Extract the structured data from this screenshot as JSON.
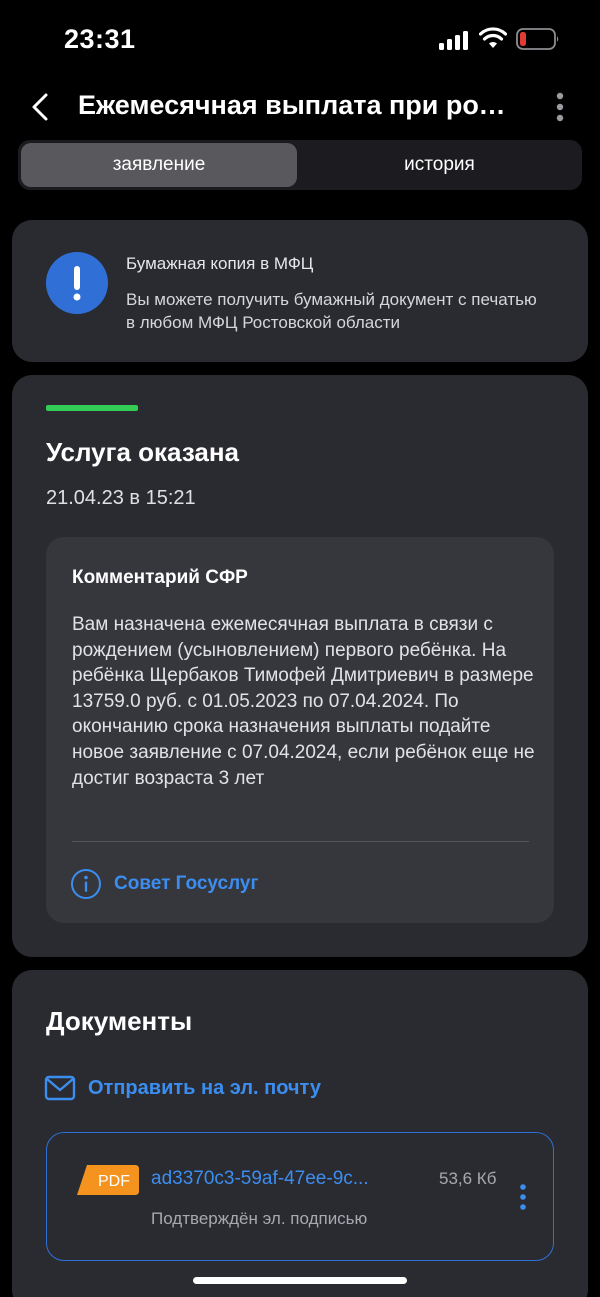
{
  "status_bar": {
    "time": "23:31",
    "icons": [
      "cellular-signal-icon",
      "wifi-icon",
      "battery-low-icon"
    ],
    "battery_color": "#e03b35"
  },
  "header": {
    "title": "Ежемесячная выплата при рождении ребёнка",
    "icons": [
      "chevron-left-icon",
      "more-vertical-icon"
    ]
  },
  "tabs": [
    {
      "label": "заявление",
      "active": true
    },
    {
      "label": "история",
      "active": false
    }
  ],
  "info_card": {
    "icon": "exclamation-icon",
    "title": "Бумажная копия в МФЦ",
    "text": "Вы можете получить бумажный документ с печатью в любом МФЦ Ростовской области"
  },
  "status_card": {
    "title": "Услуга оказана",
    "date": "21.04.23 в 15:21",
    "progress_color": "#33cc55",
    "comment": {
      "title": "Комментарий СФР",
      "text": "Вам назначена ежемесячная выплата в связи с рождением (усыновлением) первого ребёнка. На ребёнка Щербаков Тимофей Дмитриевич в размере 13759.0 руб. с 01.05.2023 по 07.04.2024. По окончанию срока назначения выплаты подайте новое заявление с 07.04.2024, если ребёнок еще не достиг возраста 3 лет",
      "link_label": "Совет Госуслуг",
      "link_icon": "info-icon"
    }
  },
  "documents": {
    "title": "Документы",
    "email_link": "Отправить на эл. почту",
    "email_icon": "mail-icon",
    "items": [
      {
        "badge": "PDF",
        "name": "ad3370c3-59af-47ee-9c...",
        "size": "53,6 Кб",
        "subtitle": "Подтверждён эл. подписью"
      }
    ]
  },
  "colors": {
    "accent": "#3b8ef0",
    "card": "#2a2b31",
    "pdf_badge": "#f5931f"
  }
}
